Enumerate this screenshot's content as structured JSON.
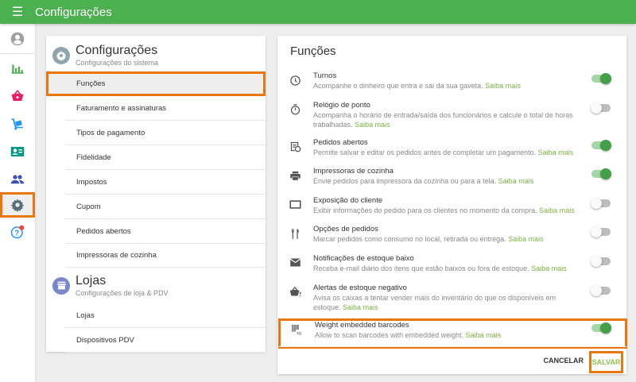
{
  "app": {
    "title": "Configurações"
  },
  "colors": {
    "primary": "#4caf50",
    "highlight": "#e8770e",
    "link": "#7cb342"
  },
  "sidebar": {
    "items": [
      {
        "name": "account",
        "icon": "account-circle-icon"
      },
      {
        "name": "reports",
        "icon": "bar-chart-icon"
      },
      {
        "name": "sales",
        "icon": "basket-icon"
      },
      {
        "name": "inventory",
        "icon": "dolly-icon"
      },
      {
        "name": "customers",
        "icon": "contact-card-icon"
      },
      {
        "name": "employees",
        "icon": "people-icon"
      },
      {
        "name": "settings",
        "icon": "gear-icon",
        "selected": true
      },
      {
        "name": "help",
        "icon": "help-icon",
        "badge": true
      }
    ]
  },
  "settings_menu": {
    "section1": {
      "title": "Configurações",
      "subtitle": "Configurações do sistema",
      "items": [
        "Funções",
        "Faturamento e assinaturas",
        "Tipos de pagamento",
        "Fidelidade",
        "Impostos",
        "Cupom",
        "Pedidos abertos",
        "Impressoras de cozinha"
      ],
      "selected": "Funções"
    },
    "section2": {
      "title": "Lojas",
      "subtitle": "Configurações de loja & PDV",
      "items": [
        "Lojas",
        "Dispositivos PDV"
      ]
    }
  },
  "features": {
    "title": "Funções",
    "link_label": "Saiba mais",
    "items": [
      {
        "title": "Turnos",
        "desc": "Acompanhe o dinheiro que entra e sai da sua gaveta.",
        "enabled": true,
        "icon": "clock-icon"
      },
      {
        "title": "Relógio de ponto",
        "desc": "Acompanha o horário de entrada/saída dos funcionários e calcule o total de horas trabalhadas.",
        "enabled": false,
        "icon": "stopwatch-icon"
      },
      {
        "title": "Pedidos abertos",
        "desc": "Permite salvar e editar os pedidos antes de completar um pagamento.",
        "enabled": true,
        "icon": "open-ticket-icon"
      },
      {
        "title": "Impressoras de cozinha",
        "desc": "Envie pedidos para impressora da cozinha ou para a tela.",
        "enabled": true,
        "icon": "printer-icon"
      },
      {
        "title": "Exposição do cliente",
        "desc": "Exibir informações do pedido para os clientes no momento da compra.",
        "enabled": false,
        "icon": "display-icon"
      },
      {
        "title": "Opções de pedidos",
        "desc": "Marcar pedidos como consumo no local, retirada ou entrega.",
        "enabled": false,
        "icon": "utensils-icon"
      },
      {
        "title": "Notificações de estoque baixo",
        "desc": "Receba e-mail diário dos itens que estão baixos ou fora de estoque.",
        "enabled": false,
        "icon": "mail-icon"
      },
      {
        "title": "Alertas de estoque negativo",
        "desc": "Avisa os caixas a tentar vender mais do inventário do que os disponíveis em estoque.",
        "enabled": false,
        "icon": "basket-alert-icon"
      },
      {
        "title": "Weight embedded barcodes",
        "desc": "Allow to scan barcodes with embedded weight.",
        "enabled": true,
        "icon": "barcode-kg-icon"
      }
    ],
    "cancel_label": "CANCELAR",
    "save_label": "SALVAR"
  }
}
